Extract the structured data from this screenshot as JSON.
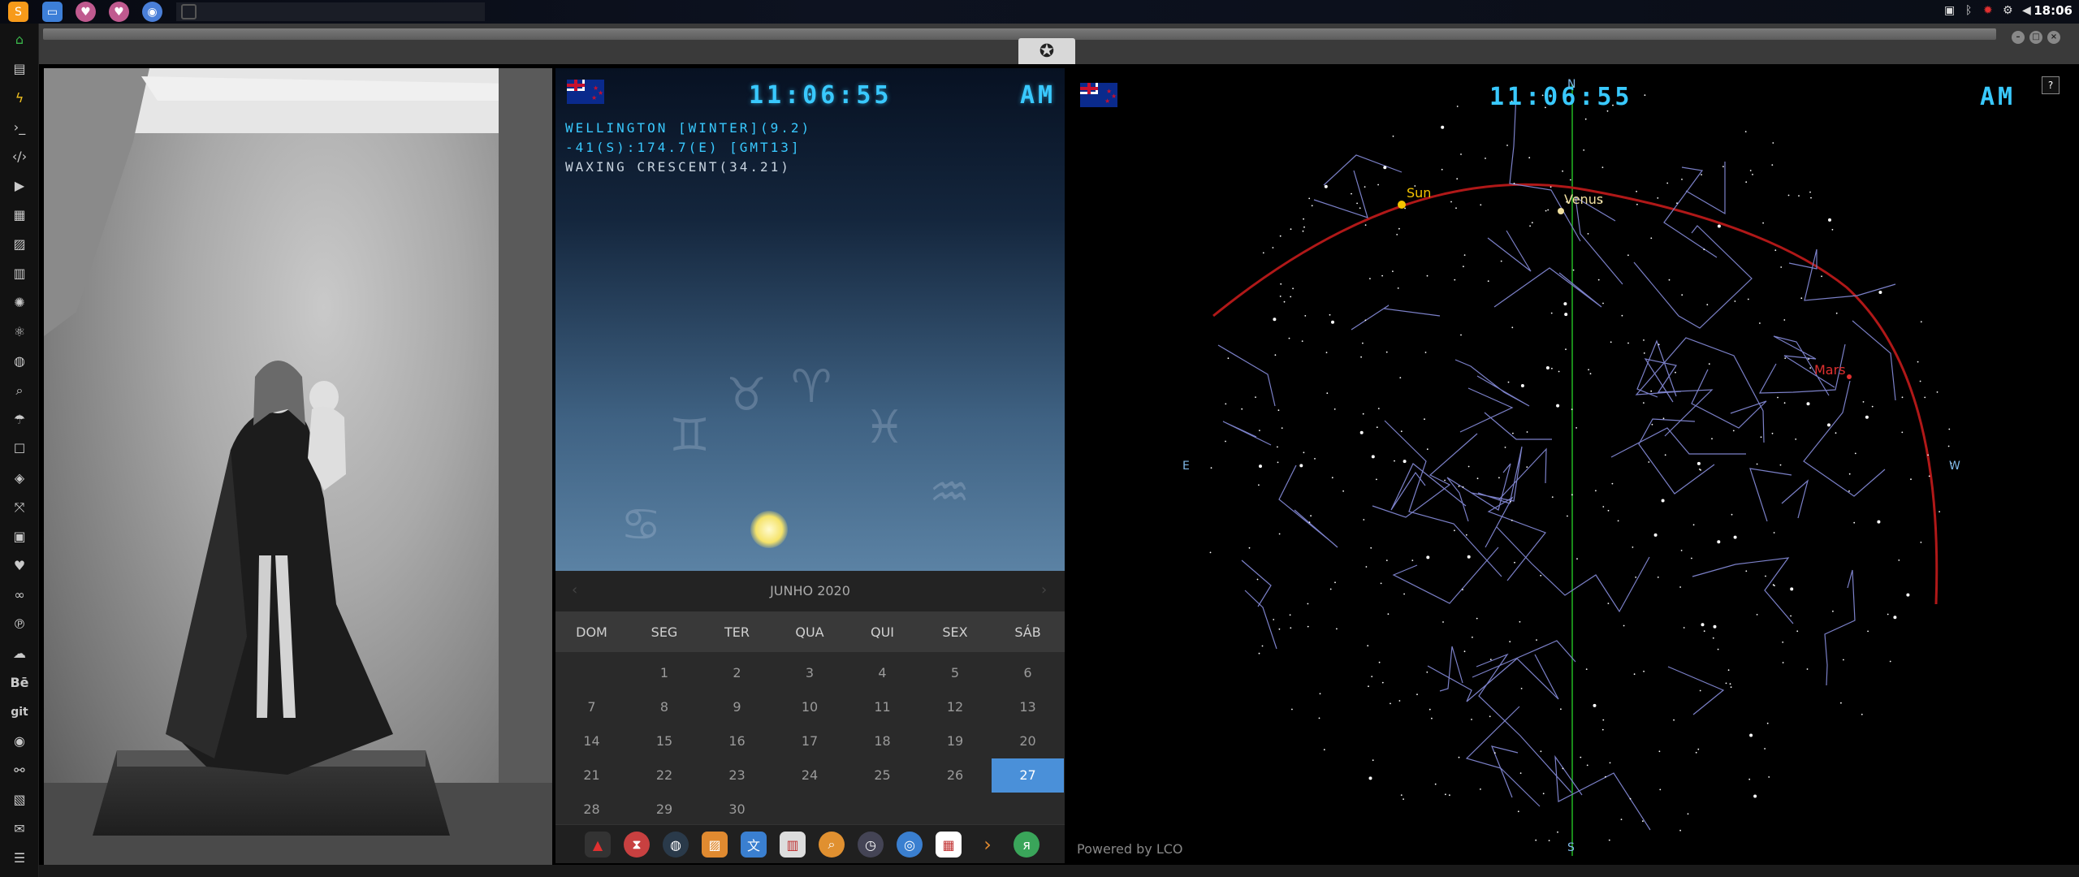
{
  "clock_panel": {
    "time": "11:06:55",
    "meridiem": "AM",
    "location_line": "WELLINGTON [WINTER](9.2)",
    "coords_line": "-41(S):174.7(E) [GMT13]",
    "moon_line": "WAXING CRESCENT(34.21)"
  },
  "calendar": {
    "month": "JUNHO 2020",
    "prev": "‹",
    "next": "›",
    "weekdays": [
      "DOM",
      "SEG",
      "TER",
      "QUA",
      "QUI",
      "SEX",
      "SÁB"
    ],
    "days": [
      "1",
      "2",
      "3",
      "4",
      "5",
      "6",
      "7",
      "8",
      "9",
      "10",
      "11",
      "12",
      "13",
      "14",
      "15",
      "16",
      "17",
      "18",
      "19",
      "20",
      "21",
      "22",
      "23",
      "24",
      "25",
      "26",
      "27",
      "28",
      "29",
      "30"
    ],
    "today": "27"
  },
  "sky": {
    "time": "11:06:55",
    "meridiem": "AM",
    "north": "N",
    "south": "S",
    "east": "E",
    "west": "W",
    "sun": "Sun",
    "venus": "Venus",
    "mars": "Mars",
    "help": "?",
    "powered": "Powered by LCO"
  },
  "system": {
    "clock": "18:06",
    "git_label": "git",
    "behance_label": "Bē"
  },
  "colors": {
    "digital": "#39c9ff",
    "today": "#4a90d9",
    "ecliptic": "#b01818",
    "meridian": "#1a8a1a",
    "sun": "#f5c400",
    "mars": "#e03030"
  }
}
